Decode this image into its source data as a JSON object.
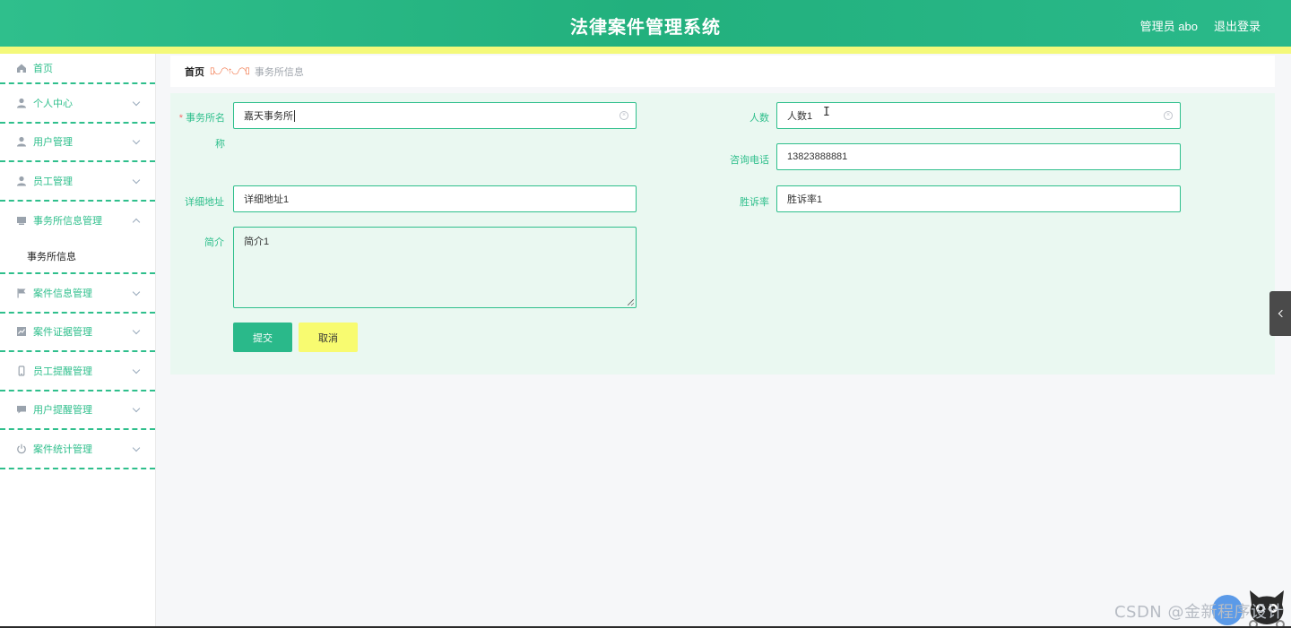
{
  "header": {
    "title": "法律案件管理系统",
    "user_label": "管理员 abo",
    "logout_label": "退出登录"
  },
  "sidebar": {
    "items": [
      {
        "label": "首页",
        "icon": "home-icon"
      },
      {
        "label": "个人中心",
        "icon": "user-icon"
      },
      {
        "label": "用户管理",
        "icon": "user-icon"
      },
      {
        "label": "员工管理",
        "icon": "user-icon"
      },
      {
        "label": "事务所信息管理",
        "icon": "office-icon",
        "expanded": true
      },
      {
        "label": "案件信息管理",
        "icon": "flag-icon"
      },
      {
        "label": "案件证据管理",
        "icon": "chart-icon"
      },
      {
        "label": "员工提醒管理",
        "icon": "phone-icon"
      },
      {
        "label": "用户提醒管理",
        "icon": "message-icon"
      },
      {
        "label": "案件统计管理",
        "icon": "power-icon"
      }
    ],
    "sub_item": "事务所信息"
  },
  "breadcrumb": {
    "home": "首页",
    "separator": "▯◡◠↑◡◠▯",
    "current": "事务所信息"
  },
  "form": {
    "name_label_line1": "事务所名",
    "name_label_line2": "称",
    "name_value": "嘉天事务所",
    "count_label": "人数",
    "count_value": "人数1",
    "phone_label": "咨询电话",
    "phone_value": "13823888881",
    "address_label": "详细地址",
    "address_value": "详细地址1",
    "winrate_label": "胜诉率",
    "winrate_value": "胜诉率1",
    "intro_label": "简介",
    "intro_value": "简介1",
    "submit_label": "提交",
    "cancel_label": "取消"
  },
  "watermark": "CSDN @金新程序设计",
  "colors": {
    "primary": "#2fbf8c",
    "accent_yellow": "#f4f97a",
    "panel_bg": "#eaf8f1"
  }
}
